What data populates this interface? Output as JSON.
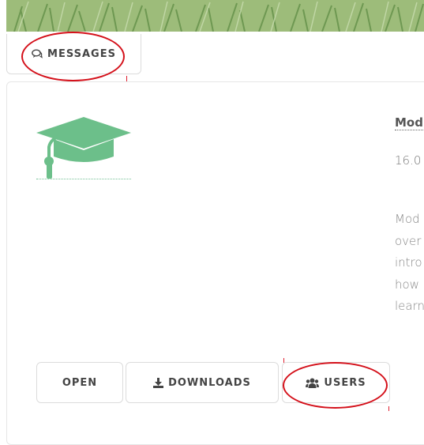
{
  "tabs": {
    "messages": {
      "label": "MESSAGES",
      "icon": "comments-icon"
    }
  },
  "course": {
    "icon": "graduation-cap-icon",
    "icon_color": "#6cbf8a",
    "title": "Mod",
    "meta": "16.0",
    "description_lines": [
      "Mod",
      "over",
      "intro",
      "how",
      "learn"
    ]
  },
  "actions": {
    "open": {
      "label": "OPEN"
    },
    "downloads": {
      "label": "DOWNLOADS",
      "icon": "download-icon"
    },
    "users": {
      "label": "USERS",
      "icon": "users-icon"
    }
  },
  "annotation_color": "#d4101a"
}
